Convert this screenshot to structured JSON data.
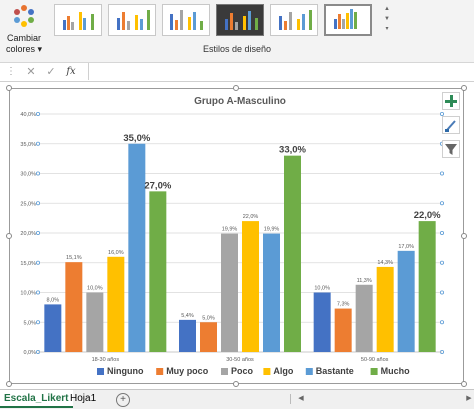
{
  "ribbon": {
    "change_colors_label_1": "Cambiar",
    "change_colors_label_2": "colores",
    "change_colors_caret": "▾",
    "group_label": "Estilos de diseño"
  },
  "formula_bar": {
    "cancel_icon": "✕",
    "enter_icon": "✓",
    "fx_label": "fx",
    "value": ""
  },
  "chart_data": {
    "type": "bar",
    "title": "Grupo A-Masculino",
    "categories": [
      "18-30 años",
      "30-50 años",
      "50-90 años"
    ],
    "series": [
      {
        "name": "Ninguno",
        "color": "#4472c4",
        "values": [
          8.0,
          5.4,
          10.0
        ],
        "labels": [
          "8,0%",
          "5,4%",
          "10,0%"
        ]
      },
      {
        "name": "Muy poco",
        "color": "#ed7d31",
        "values": [
          15.1,
          5.0,
          7.3
        ],
        "labels": [
          "15,1%",
          "5,0%",
          "7,3%"
        ]
      },
      {
        "name": "Poco",
        "color": "#a5a5a5",
        "values": [
          10.0,
          19.9,
          11.3
        ],
        "labels": [
          "10,0%",
          "19,9%",
          "11,3%"
        ]
      },
      {
        "name": "Algo",
        "color": "#ffc000",
        "values": [
          16.0,
          22.0,
          14.3
        ],
        "labels": [
          "16,0%",
          "22,0%",
          "14,3%"
        ]
      },
      {
        "name": "Bastante",
        "color": "#5b9bd5",
        "values": [
          35.0,
          19.9,
          17.0
        ],
        "labels": [
          "35,0%",
          "19,9%",
          "17,0%"
        ]
      },
      {
        "name": "Mucho",
        "color": "#70ad47",
        "values": [
          27.0,
          33.0,
          22.0
        ],
        "labels": [
          "27,0%",
          "33,0%",
          "22,0%"
        ]
      }
    ],
    "large_labels": [
      "35,0%",
      "27,0%",
      "33,0%",
      "22,0%"
    ],
    "yticks": [
      "0,0%",
      "5,0%",
      "10,0%",
      "15,0%",
      "20,0%",
      "25,0%",
      "30,0%",
      "35,0%",
      "40,0%"
    ],
    "ylim": [
      0,
      40
    ],
    "grid": true,
    "legend_position": "bottom"
  },
  "chart_tools": {
    "add_element_icon": "plus-icon",
    "style_icon": "brush-icon",
    "filter_icon": "filter-icon"
  },
  "sheet_tabs": {
    "tabs": [
      "Escala_Likert",
      "Hoja1"
    ],
    "add_icon": "+",
    "prev_icon": "◀",
    "next_icon": "▶"
  }
}
